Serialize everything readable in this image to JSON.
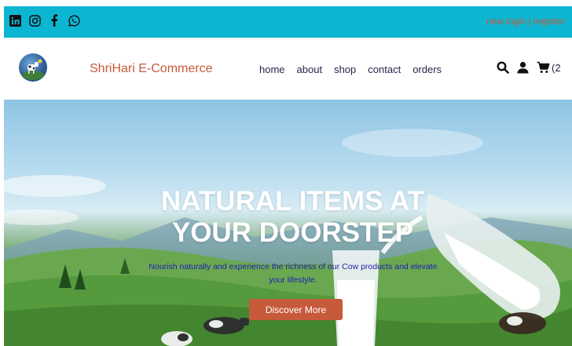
{
  "topbar": {
    "social_icons": [
      "linkedin-icon",
      "instagram-icon",
      "facebook-icon",
      "whatsapp-icon"
    ],
    "auth": {
      "login": "new login",
      "separator": "|",
      "register": "register"
    }
  },
  "navbar": {
    "brand": "ShriHari E-Commerce",
    "menu": [
      "home",
      "about",
      "shop",
      "contact",
      "orders"
    ],
    "cart_count": "(2"
  },
  "hero": {
    "title": "NATURAL ITEMS AT YOUR DOORSTEP",
    "subtitle": "Nourish naturally and experience the richness of our Cow products and elevate your lifestyle.",
    "cta": "Discover More"
  },
  "colors": {
    "topbar": "#0cb6d3",
    "accent": "#c65a3a",
    "nav_text": "#2c1d4a",
    "subtitle_text": "#1d1db8"
  }
}
